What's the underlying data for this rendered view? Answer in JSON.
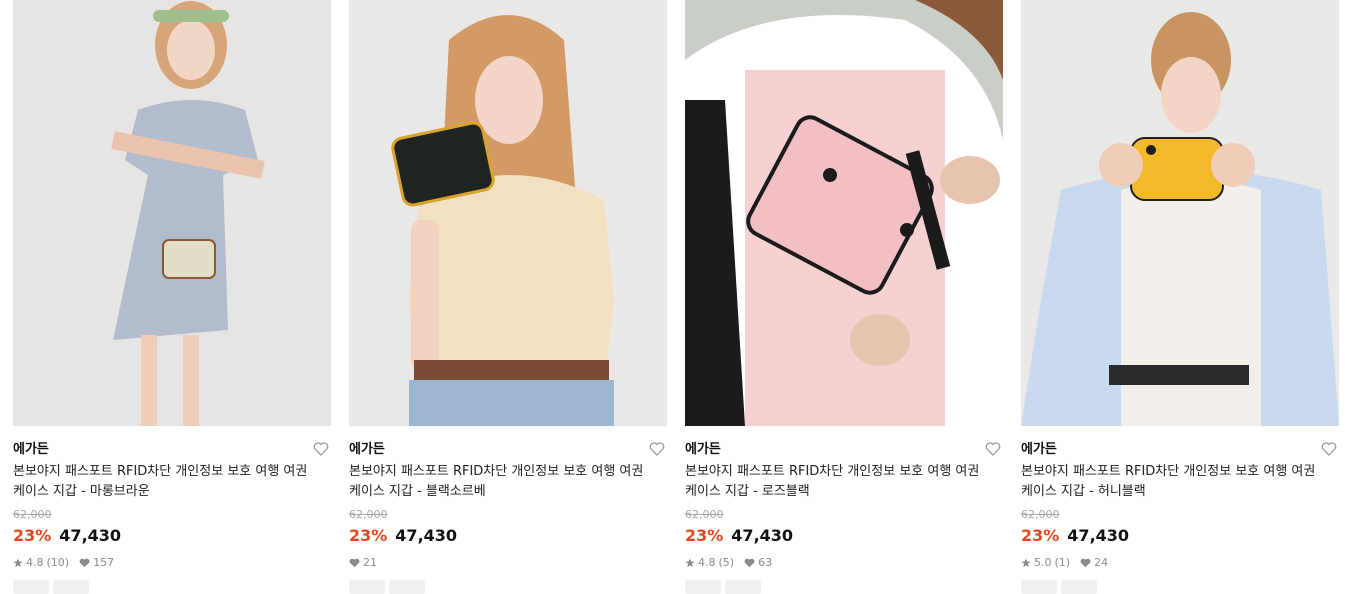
{
  "products": [
    {
      "brand": "에가든",
      "title": "본보야지 패스포트 RFID차단 개인정보 보호 여행 여권 케이스 지갑 - 마롱브라운",
      "original_price": "62,000",
      "discount": "23%",
      "price": "47,430",
      "rating": "4.8",
      "review_count": "(10)",
      "likes": "157",
      "tags": [
        "",
        ""
      ],
      "bag_color": "#e2dfc6",
      "outfit_color": "#aab4c7"
    },
    {
      "brand": "에가든",
      "title": "본보야지 패스포트 RFID차단 개인정보 보호 여행 여권 케이스 지갑 - 블랙소르베",
      "original_price": "62,000",
      "discount": "23%",
      "price": "47,430",
      "likes": "21",
      "tags": [
        "",
        ""
      ],
      "bag_color": "#1f2421",
      "outfit_color": "#f1e1c2"
    },
    {
      "brand": "에가든",
      "title": "본보야지 패스포트 RFID차단 개인정보 보호 여행 여권 케이스 지갑 - 로즈블랙",
      "original_price": "62,000",
      "discount": "23%",
      "price": "47,430",
      "rating": "4.8",
      "review_count": "(5)",
      "likes": "63",
      "tags": [
        "",
        ""
      ],
      "bag_color": "#f2bfc4",
      "outfit_color": "#f6d1d2"
    },
    {
      "brand": "에가든",
      "title": "본보야지 패스포트 RFID차단 개인정보 보호 여행 여권 케이스 지갑 - 허니블랙",
      "original_price": "62,000",
      "discount": "23%",
      "price": "47,430",
      "rating": "5.0",
      "review_count": "(1)",
      "likes": "24",
      "tags": [
        "",
        ""
      ],
      "bag_color": "#f2b92a",
      "outfit_color": "#c9d9ef"
    }
  ],
  "colors": {
    "discount": "#f0431f",
    "muted": "#8a8a8a"
  },
  "icons": {
    "wishlist": "heart-outline-icon",
    "rating": "star-icon",
    "likes": "heart-filled-icon"
  }
}
